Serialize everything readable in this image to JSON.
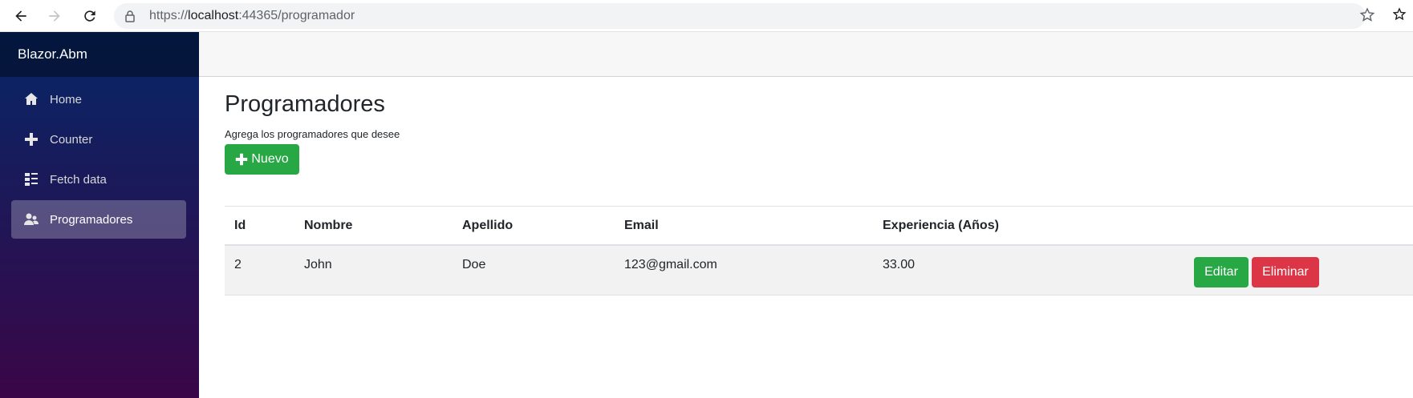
{
  "browser": {
    "url_prefix": "https://",
    "url_host": "localhost",
    "url_rest": ":44365/programador"
  },
  "sidebar": {
    "brand": "Blazor.Abm",
    "items": [
      {
        "label": "Home",
        "icon": "home-icon"
      },
      {
        "label": "Counter",
        "icon": "plus-icon"
      },
      {
        "label": "Fetch data",
        "icon": "list-icon"
      },
      {
        "label": "Programadores",
        "icon": "people-icon",
        "active": true
      }
    ]
  },
  "main": {
    "title": "Programadores",
    "subtitle": "Agrega los programadores que desee",
    "new_button": "Nuevo",
    "table": {
      "headers": [
        "Id",
        "Nombre",
        "Apellido",
        "Email",
        "Experiencia (Años)"
      ],
      "rows": [
        {
          "id": "2",
          "nombre": "John",
          "apellido": "Doe",
          "email": "123@gmail.com",
          "experiencia": "33.00"
        }
      ],
      "edit_label": "Editar",
      "delete_label": "Eliminar"
    }
  },
  "colors": {
    "success": "#28a745",
    "danger": "#dc3545",
    "sidebar_top": "#052767",
    "sidebar_bottom": "#3a0647"
  }
}
